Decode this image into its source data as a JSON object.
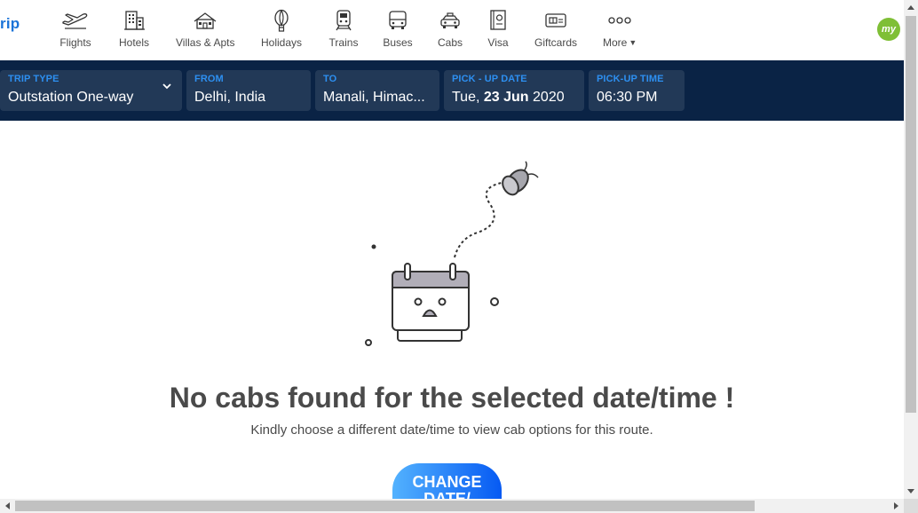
{
  "brand": {
    "logo_text": "rip"
  },
  "nav": {
    "items": [
      {
        "label": "Flights",
        "icon": "flight-icon"
      },
      {
        "label": "Hotels",
        "icon": "hotel-icon"
      },
      {
        "label": "Villas & Apts",
        "icon": "villa-icon"
      },
      {
        "label": "Holidays",
        "icon": "holiday-balloon-icon"
      },
      {
        "label": "Trains",
        "icon": "train-icon"
      },
      {
        "label": "Buses",
        "icon": "bus-icon"
      },
      {
        "label": "Cabs",
        "icon": "cab-icon"
      },
      {
        "label": "Visa",
        "icon": "passport-icon"
      },
      {
        "label": "Giftcards",
        "icon": "giftcard-icon"
      },
      {
        "label": "More",
        "icon": "more-dots-icon"
      }
    ],
    "avatar_text": "my"
  },
  "search": {
    "trip_type": {
      "label": "TRIP TYPE",
      "value": "Outstation One-way"
    },
    "from": {
      "label": "FROM",
      "value": "Delhi, India"
    },
    "to": {
      "label": "TO",
      "value": "Manali, Himac..."
    },
    "pickup_date": {
      "label": "PICK - UP DATE",
      "weekday": "Tue,",
      "day_month": "23 Jun",
      "year": "2020"
    },
    "pickup_time": {
      "label": "PICK-UP TIME",
      "value": "06:30 PM"
    }
  },
  "empty_state": {
    "headline": "No cabs found for the selected date/time !",
    "subline": "Kindly choose a different date/time to view cab options for this route.",
    "cta_label": "CHANGE DATE/"
  },
  "colors": {
    "header_bg": "#0a2345",
    "field_label": "#2d8ff0",
    "brand_blue": "#1a73d8",
    "cta_gradient_start": "#53b2fe",
    "cta_gradient_end": "#065af3",
    "avatar_bg": "#7fbf36"
  }
}
